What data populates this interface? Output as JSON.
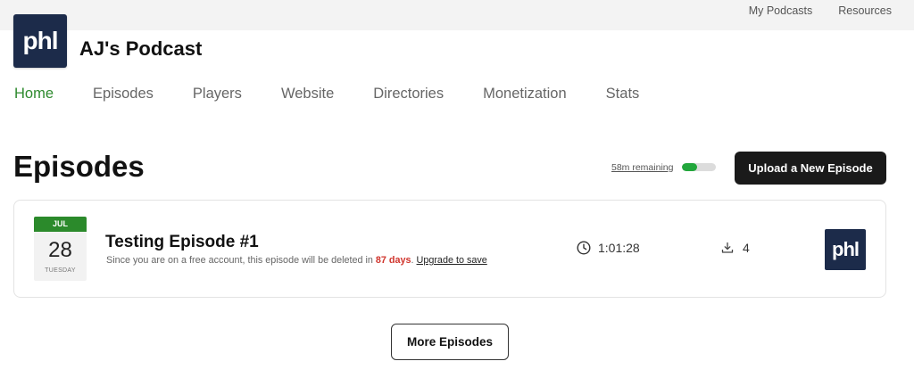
{
  "topbar": {
    "links": [
      "My Podcasts",
      "Resources"
    ]
  },
  "brand": {
    "logo_text": "phl",
    "podcast_title": "AJ's Podcast"
  },
  "nav": {
    "items": [
      "Home",
      "Episodes",
      "Players",
      "Website",
      "Directories",
      "Monetization",
      "Stats"
    ],
    "active": "Home"
  },
  "episodes_header": {
    "title": "Episodes",
    "remaining_label": "58m remaining",
    "usage_progress": 0.45,
    "upload_label": "Upload a New Episode"
  },
  "episode": {
    "month": "JUL",
    "day": "28",
    "weekday": "TUESDAY",
    "title": "Testing Episode #1",
    "note_prefix": "Since you are on a free account, this episode will be deleted in ",
    "note_days": "87 days",
    "note_suffix": ". ",
    "upgrade_label": "Upgrade to save",
    "duration": "1:01:28",
    "downloads": "4",
    "thumb_text": "phl"
  },
  "more_label": "More Episodes",
  "colors": {
    "accent_green": "#2e8a2e",
    "progress_green": "#22a73c",
    "warning_red": "#d0342c",
    "brand_navy": "#1c2b4a",
    "button_dark": "#1a1a1a"
  }
}
